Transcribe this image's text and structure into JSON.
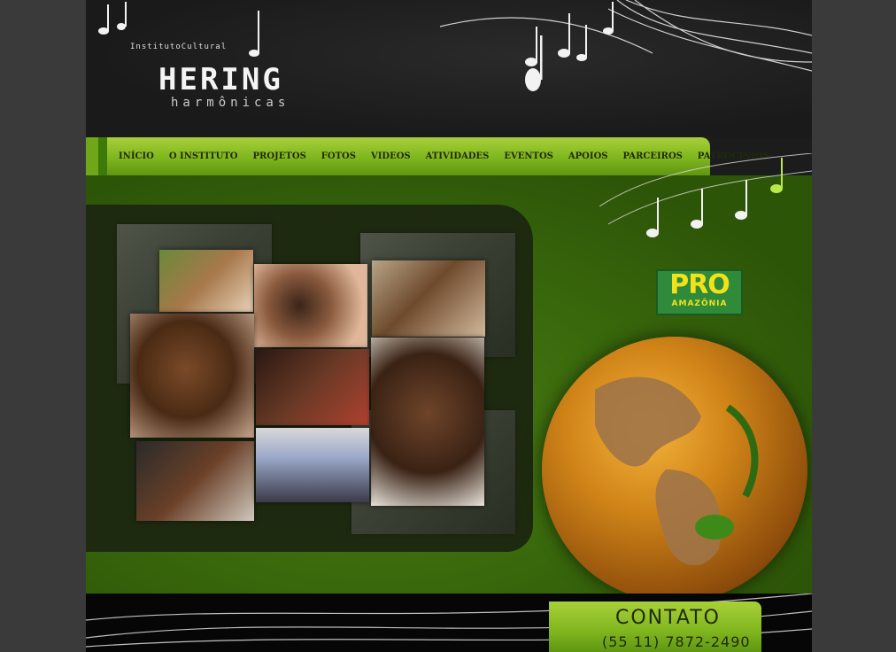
{
  "logo": {
    "small": "InstitutoCultural",
    "name": "HERING",
    "sub": "harmônicas"
  },
  "nav": {
    "items": [
      "INÍCIO",
      "O INSTITUTO",
      "PROJETOS",
      "FOTOS",
      "VIDEOS",
      "ATIVIDADES",
      "EVENTOS",
      "APOIOS",
      "PARCEIROS",
      "PATROCINIOS"
    ]
  },
  "promo": {
    "line1": "PRO",
    "line2": "AMAZÔNIA"
  },
  "contact": {
    "label": "CONTATO",
    "phone": "(55 11) 7872-2490"
  },
  "colors": {
    "nav_green": "#7fb51e",
    "content_green": "#3a6a0c",
    "background_dark": "#1c1c1c",
    "promo_yellow": "#f2e21a"
  }
}
